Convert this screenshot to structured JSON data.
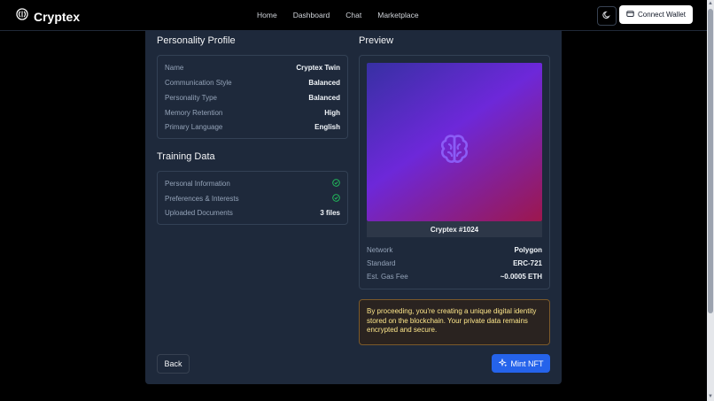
{
  "brand": {
    "name": "Cryptex"
  },
  "nav": {
    "items": [
      "Home",
      "Dashboard",
      "Chat",
      "Marketplace"
    ]
  },
  "header": {
    "connect_wallet_label": "Connect Wallet"
  },
  "personality": {
    "title": "Personality Profile",
    "rows": [
      {
        "label": "Name",
        "value": "Cryptex Twin"
      },
      {
        "label": "Communication Style",
        "value": "Balanced"
      },
      {
        "label": "Personality Type",
        "value": "Balanced"
      },
      {
        "label": "Memory Retention",
        "value": "High"
      },
      {
        "label": "Primary Language",
        "value": "English"
      }
    ]
  },
  "training": {
    "title": "Training Data",
    "rows": [
      {
        "label": "Personal Information",
        "icon": "check-circle-icon"
      },
      {
        "label": "Preferences & Interests",
        "icon": "check-circle-icon"
      },
      {
        "label": "Uploaded Documents",
        "value": "3 files"
      }
    ]
  },
  "preview": {
    "title": "Preview",
    "nft_name": "Cryptex #1024",
    "image_icon": "brain-icon",
    "rows": [
      {
        "label": "Network",
        "value": "Polygon"
      },
      {
        "label": "Standard",
        "value": "ERC-721"
      },
      {
        "label": "Est. Gas Fee",
        "value": "~0.0005 ETH"
      }
    ]
  },
  "notice": {
    "text": "By proceeding, you're creating a unique digital identity stored on the blockchain. Your private data remains encrypted and secure."
  },
  "actions": {
    "back_label": "Back",
    "mint_label": "Mint NFT"
  },
  "colors": {
    "accent": "#2563eb",
    "check": "#22c55e",
    "notice_text": "#fde68a"
  }
}
